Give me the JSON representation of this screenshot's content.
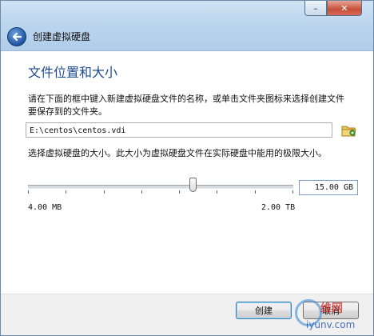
{
  "window": {
    "minimize_glyph": "–",
    "close_glyph": "✕"
  },
  "header": {
    "dialog_title": "创建虚拟硬盘"
  },
  "main": {
    "heading": "文件位置和大小",
    "location_description": "请在下面的框中键入新建虚拟硬盘文件的名称，或单击文件夹图标来选择创建文件要保存到的文件夹。",
    "file_path": "E:\\centos\\centos.vdi",
    "size_description": "选择虚拟硬盘的大小。此大小为虚拟硬盘文件在实际硬盘中能用的极限大小。",
    "size_value": "15.00 GB",
    "size_slider_fraction": 0.62,
    "range_min_label": "4.00 MB",
    "range_max_label": "2.00 TB"
  },
  "footer": {
    "create_label": "创建",
    "cancel_label": "取消"
  },
  "watermark": {
    "text": "维网",
    "url": "iyunv.com"
  },
  "icons": {
    "back": "back-arrow-icon",
    "folder": "folder-icon",
    "close": "close-icon",
    "minimize": "minimize-icon"
  },
  "colors": {
    "heading": "#1d4a8f",
    "titlebar": "#bcd6ee",
    "close_button": "#c74f3a"
  }
}
